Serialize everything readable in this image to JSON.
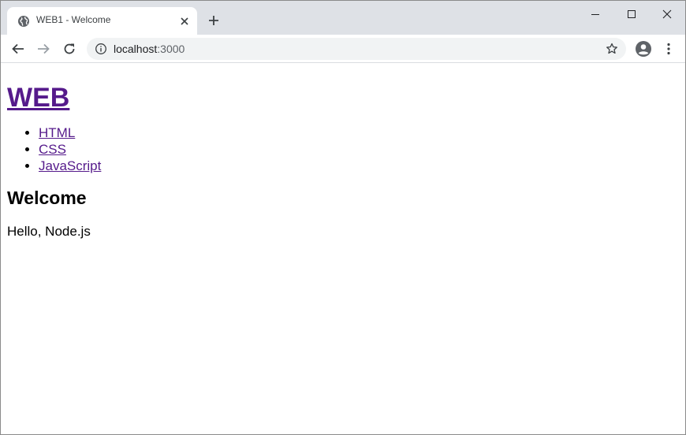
{
  "browser": {
    "tab": {
      "title": "WEB1 - Welcome",
      "favicon": "globe-icon"
    },
    "address": {
      "host": "localhost",
      "port": ":3000"
    }
  },
  "page": {
    "heading": "WEB",
    "nav": [
      {
        "label": "HTML"
      },
      {
        "label": "CSS"
      },
      {
        "label": "JavaScript"
      }
    ],
    "title": "Welcome",
    "body": "Hello, Node.js"
  },
  "colors": {
    "tabstrip": "#dee1e6",
    "link_visited": "#551a8b",
    "omnibox": "#f1f3f4"
  }
}
